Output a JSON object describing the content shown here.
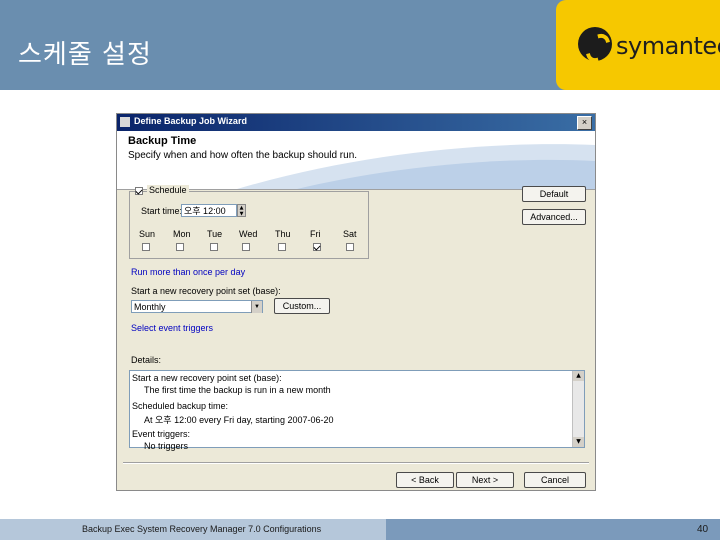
{
  "slide": {
    "title": "스케줄 설정",
    "logo_text": "symantec.",
    "footer_text": "Backup Exec System Recovery Manager 7.0 Configurations",
    "page_number": "40",
    "colors": {
      "header": "#6a8eaf",
      "logo_bg": "#f6c800",
      "footer_light": "#b5c7da",
      "footer_dark": "#7b9abb"
    }
  },
  "dialog": {
    "title": "Define Backup Job Wizard",
    "close_label": "×",
    "header_title": "Backup Time",
    "header_subtitle": "Specify when and how often the backup should run.",
    "schedule": {
      "label": "Schedule",
      "checked": true,
      "start_time_label": "Start time:",
      "start_time_value": "오후 12:00",
      "days": [
        {
          "label": "Sun",
          "checked": false
        },
        {
          "label": "Mon",
          "checked": false
        },
        {
          "label": "Tue",
          "checked": false
        },
        {
          "label": "Wed",
          "checked": false
        },
        {
          "label": "Thu",
          "checked": false
        },
        {
          "label": "Fri",
          "checked": true
        },
        {
          "label": "Sat",
          "checked": false
        }
      ]
    },
    "buttons": {
      "default": "Default",
      "advanced": "Advanced...",
      "custom": "Custom...",
      "back": "< Back",
      "next": "Next >",
      "cancel": "Cancel"
    },
    "run_more_link": "Run more than once per day",
    "recovery_label": "Start a new recovery point set (base):",
    "recovery_value": "Monthly",
    "event_triggers_link": "Select event triggers",
    "details_label": "Details:",
    "details_lines": [
      "Start a new recovery point set (base):",
      "The first time the backup is run in a new month",
      "Scheduled backup time:",
      "At 오후 12:00 every Fri day, starting 2007-06-20",
      "Event triggers:",
      "No triggers"
    ]
  }
}
